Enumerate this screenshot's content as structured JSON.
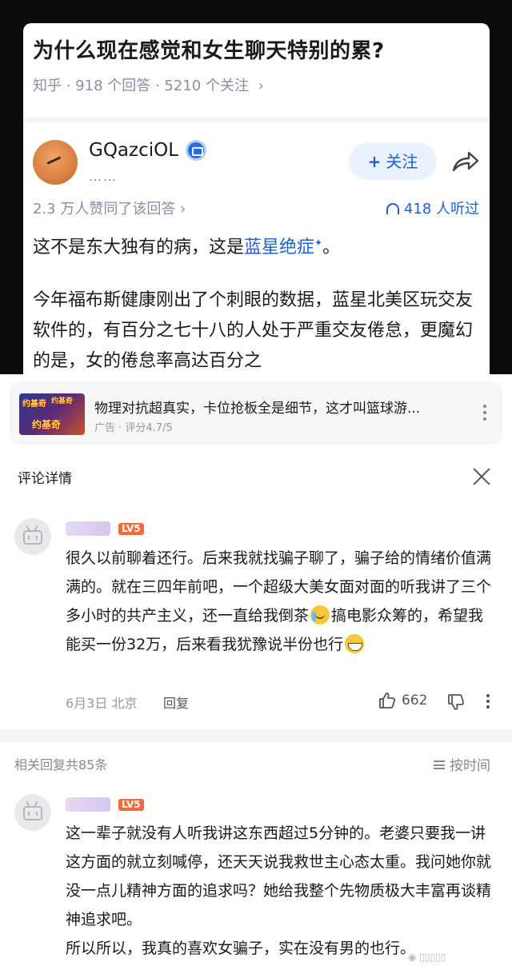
{
  "zhihu": {
    "question_title": "为什么现在感觉和女生聊天特别的累?",
    "source": "知乎",
    "answers": "918 个回答",
    "followers": "5210 个关注",
    "author_name": "GQazciOL",
    "author_sub": "……",
    "follow_label": "关注",
    "approvals": "2.3 万人赞同了该回答",
    "listened": "418 人听过",
    "p1_before": "这不是东大独有的病，这是",
    "p1_link": "蓝星绝症",
    "p1_after": "。",
    "p2": "今年福布斯健康刚出了个刺眼的数据，蓝星北美区玩交友软件的，有百分之七十八的人处于严重交友倦怠，更魔幻的是，女的倦怠率高达百分之"
  },
  "ad": {
    "image_text": "约基奇",
    "title": "物理对抗超真实，卡位抢板全是细节，这才叫篮球游...",
    "sub": "广告 · 评分4.7/5"
  },
  "comment_detail": {
    "header": "评论详情",
    "main_comment": {
      "level": "LV5",
      "text_a": "很久以前聊着还行。后来我就找骗子聊了，骗子给的情绪价值满满的。就在三四年前吧，一个超级大美女面对面的听我讲了三个多小时的共产主义，还一直给我倒茶",
      "text_b": "搞电影众筹的，希望我能买一份32万，后来看我犹豫说半份也行",
      "date": "6月3日",
      "location": "北京",
      "reply_label": "回复",
      "likes": "662"
    },
    "related_header": "相关回复共85条",
    "sort_label": "按时间",
    "reply_comment": {
      "level": "LV5",
      "text": "这一辈子就没有人听我讲这东西超过5分钟的。老婆只要我一讲这方面的就立刻喊停，还天天说我救世主心态太重。我问她你就没一点儿精神方面的追求吗？她给我整个先物质极大丰富再谈精神追求吧。",
      "text2": "所以所以，我真的喜欢女骗子，实在没有男的也行。"
    }
  },
  "colors": {
    "accent_blue": "#1f5fd1",
    "level_badge": "#f56a3a",
    "muted_gray": "#8590a6"
  },
  "icons": [
    "verified-badge-icon",
    "share-icon",
    "headphones-icon",
    "close-icon",
    "like-icon",
    "dislike-icon",
    "more-icon",
    "sort-icon",
    "tv-avatar-icon"
  ]
}
